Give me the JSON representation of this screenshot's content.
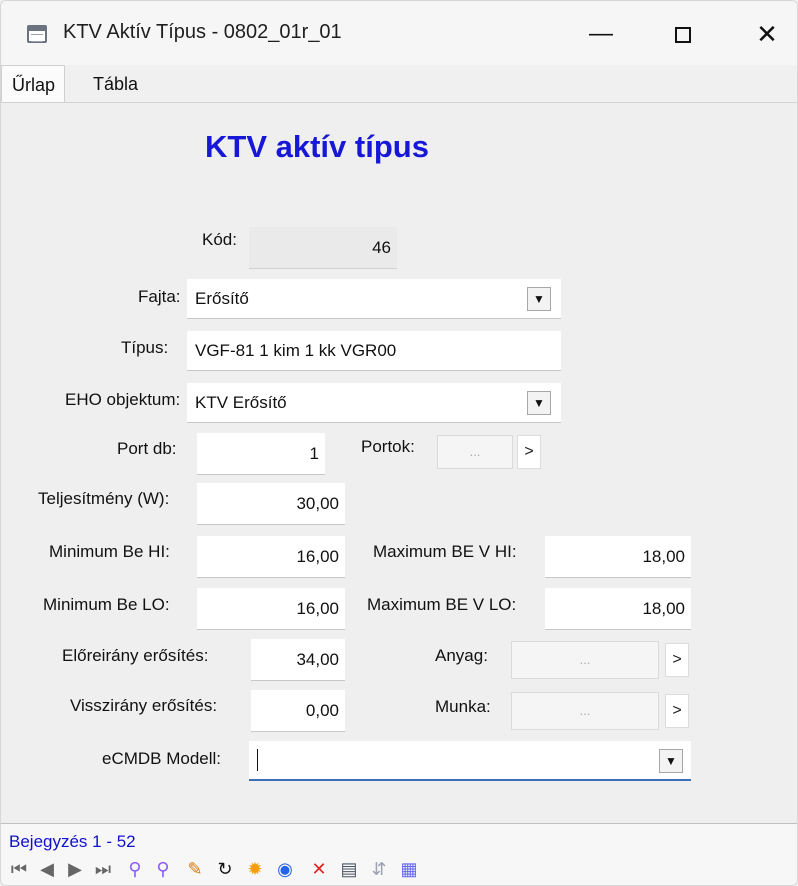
{
  "window": {
    "title": "KTV Aktív Típus - 0802_01r_01",
    "minimize": "—",
    "close": "✕"
  },
  "tabs": [
    "Űrlap",
    "Tábla"
  ],
  "form": {
    "heading": "KTV aktív típus",
    "kod": {
      "label": "Kód:",
      "value": "46"
    },
    "fajta": {
      "label": "Fajta:",
      "value": "Erősítő"
    },
    "tipus": {
      "label": "Típus:",
      "value": "VGF-81 1 kim 1 kk VGR00"
    },
    "eho": {
      "label": "EHO objektum:",
      "value": "KTV Erősítő"
    },
    "port_db": {
      "label": "Port db:",
      "value": "1"
    },
    "portok": {
      "label": "Portok:",
      "button": "...",
      "arrow": ">"
    },
    "teljesitmeny": {
      "label": "Teljesítmény (W):",
      "value": "30,00"
    },
    "min_be_hi": {
      "label": "Minimum Be HI:",
      "value": "16,00"
    },
    "max_be_hi": {
      "label": "Maximum BE V HI:",
      "value": "18,00"
    },
    "min_be_lo": {
      "label": "Minimum Be LO:",
      "value": "16,00"
    },
    "max_be_lo": {
      "label": "Maximum BE V LO:",
      "value": "18,00"
    },
    "eloreirany": {
      "label": "Előreirány erősítés:",
      "value": "34,00"
    },
    "visszirany": {
      "label": "Visszirány erősítés:",
      "value": "0,00"
    },
    "anyag": {
      "label": "Anyag:",
      "button": "...",
      "arrow": ">"
    },
    "munka": {
      "label": "Munka:",
      "button": "...",
      "arrow": ">"
    },
    "ecmdb": {
      "label": "eCMDB Modell:",
      "value": ""
    },
    "dropdown_glyph": "▼"
  },
  "navigation": {
    "record_text": "Bejegyzés 1 - 52",
    "icons": [
      {
        "name": "first-record-icon",
        "glyph": "⏮",
        "color": "#666666"
      },
      {
        "name": "prev-record-icon",
        "glyph": "◀",
        "color": "#666666"
      },
      {
        "name": "next-record-icon",
        "glyph": "▶",
        "color": "#666666"
      },
      {
        "name": "last-record-icon",
        "glyph": "⏭",
        "color": "#666666"
      },
      {
        "name": "add-filter-icon",
        "glyph": "⚲",
        "color": "#8b5cf6"
      },
      {
        "name": "filter-icon",
        "glyph": "⚲",
        "color": "#8b5cf6"
      },
      {
        "name": "edit-icon",
        "glyph": "✎",
        "color": "#d97706"
      },
      {
        "name": "refresh-icon",
        "glyph": "↻",
        "color": "#111111"
      },
      {
        "name": "new-record-icon",
        "glyph": "✹",
        "color": "#f59e0b"
      },
      {
        "name": "web-icon",
        "glyph": "◉",
        "color": "#2563eb"
      },
      {
        "name": "delete-icon",
        "glyph": "✕",
        "color": "#dc2626"
      },
      {
        "name": "print-icon",
        "glyph": "▤",
        "color": "#4b5563"
      },
      {
        "name": "split-icon",
        "glyph": "⇵",
        "color": "#9ca3af"
      },
      {
        "name": "table-export-icon",
        "glyph": "▦",
        "color": "#6366f1"
      }
    ]
  }
}
